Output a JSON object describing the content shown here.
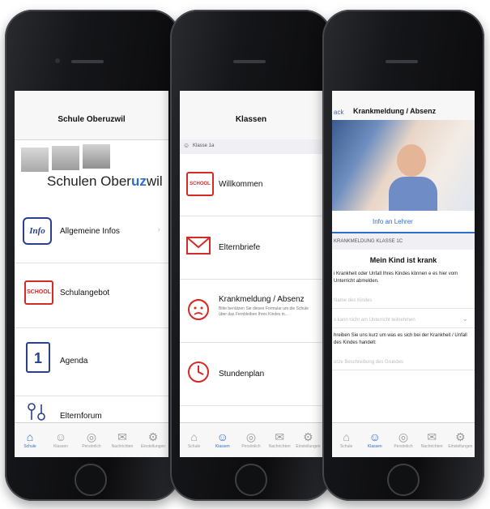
{
  "phone1": {
    "title": "Schule Oberuzwil",
    "logo_text": "Schulen Ober",
    "logo_accent": "uz",
    "logo_end": "wil",
    "items": [
      {
        "label": "Allgemeine Infos",
        "icon": "info-icon"
      },
      {
        "label": "Schulangebot",
        "icon": "school-icon"
      },
      {
        "label": "Agenda",
        "icon": "calendar-icon"
      },
      {
        "label": "Elternforum",
        "icon": "forum-icon"
      }
    ]
  },
  "phone2": {
    "title": "Klassen",
    "section": "Klasse 1a",
    "items": [
      {
        "label": "Willkommen",
        "icon": "school-icon"
      },
      {
        "label": "Elternbriefe",
        "icon": "envelope-icon"
      },
      {
        "label": "Krankmeldung / Absenz",
        "icon": "sick-child-icon",
        "sub": "Bitte benützen Sie dieses Formular um die Schule über das Fernbleiben Ihres Kindes in..."
      },
      {
        "label": "Stundenplan",
        "icon": "clock-icon"
      }
    ]
  },
  "phone3": {
    "back": "ack",
    "title": "Krankmeldung / Absenz",
    "tab_label": "Info an Lehrer",
    "section": "KRANKMELDUNG KLASSE 1C",
    "heading": "Mein Kind ist krank",
    "intro": "i Krankheit oder Unfall Ihres Kindes können e es hier vom Unterricht abmelden.",
    "name_placeholder": "Name des Kindes",
    "reason_placeholder": "s kann nicht am Unterricht teilnehmen",
    "describe": "hreiben Sie uns kurz um was es sich bei der Krankheit / Unfall des Kindes handelt:",
    "short_placeholder": "urze Beschreibung des Grundes"
  },
  "tabs": [
    "Schule",
    "Klassen",
    "Persönlich",
    "Nachrichten",
    "Einstellungen"
  ],
  "colors": {
    "accent": "#2d6fc8",
    "icon_red": "#d42b26",
    "icon_blue": "#2b3f8f"
  }
}
